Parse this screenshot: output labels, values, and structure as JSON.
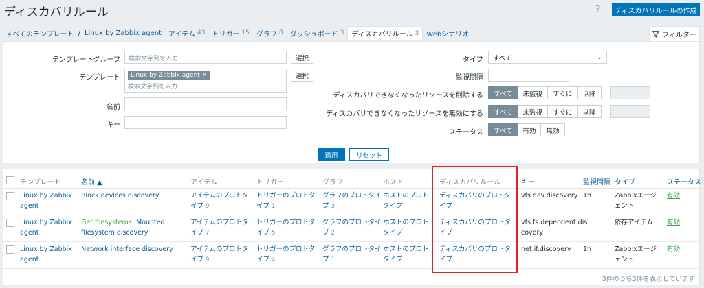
{
  "header": {
    "title": "ディスカバリルール",
    "help_icon": "?",
    "create_label": "ディスカバリルールの作成"
  },
  "breadcrumb": {
    "all_templates": "すべてのテンプレート",
    "separator": "/",
    "template": "Linux by Zabbix agent",
    "tabs": [
      {
        "label": "アイテム",
        "count": "43"
      },
      {
        "label": "トリガー",
        "count": "15"
      },
      {
        "label": "グラフ",
        "count": "8"
      },
      {
        "label": "ダッシュボード",
        "count": "3"
      },
      {
        "label": "ディスカバリルール",
        "count": "3"
      },
      {
        "label": "Webシナリオ",
        "count": ""
      }
    ]
  },
  "filter": {
    "tab_label": "フィルター",
    "template_group_label": "テンプレートグループ",
    "template_group_placeholder": "検索文字列を入力",
    "select_label": "選択",
    "template_label": "テンプレート",
    "template_chip": "Linux by Zabbix agent",
    "template_placeholder": "検索文字列を入力",
    "name_label": "名前",
    "key_label": "キー",
    "type_label": "タイプ",
    "type_value": "すべて",
    "interval_label": "監視間隔",
    "delete_lost_label": "ディスカバリできなくなったリソースを削除する",
    "disable_lost_label": "ディスカバリできなくなったリソースを無効にする",
    "lost_options": [
      "すべて",
      "未監視",
      "すぐに",
      "以降"
    ],
    "status_label": "ステータス",
    "status_options": [
      "すべて",
      "有効",
      "無効"
    ],
    "apply_label": "適用",
    "reset_label": "リセット"
  },
  "table": {
    "headers": {
      "template": "テンプレート",
      "name": "名前 ▲",
      "items": "アイテム",
      "triggers": "トリガー",
      "graphs": "グラフ",
      "hosts": "ホスト",
      "discovery": "ディスカバリルール",
      "key": "キー",
      "interval": "監視間隔",
      "type": "タイプ",
      "status": "ステータス"
    },
    "rows": [
      {
        "template_l1": "Linux by Zabbix",
        "template_l2": "agent",
        "name_l1": "Block devices discovery",
        "name_l2": "",
        "items_l1": "アイテムのプロトタ",
        "items_l2": "イプ",
        "items_count": "9",
        "triggers_l1": "トリガーのプロトタ",
        "triggers_l2": "イプ",
        "triggers_count": "1",
        "graphs_l1": "グラフのプロトタイ",
        "graphs_l2": "プ",
        "graphs_count": "3",
        "hosts_l1": "ホストのプロト",
        "hosts_l2": "タイプ",
        "discovery_l1": "ディスカバリのプロトタ",
        "discovery_l2": "イプ",
        "key_l1": "vfs.dev.discovery",
        "key_l2": "",
        "interval": "1h",
        "type_l1": "Zabbixエージ",
        "type_l2": "ェント",
        "status": "有効"
      },
      {
        "template_l1": "Linux by Zabbix",
        "template_l2": "agent",
        "name_prefix": "Get filesystems",
        "name_l1": ": Mounted",
        "name_l2": "filesystem discovery",
        "items_l1": "アイテムのプロトタ",
        "items_l2": "イプ",
        "items_count": "7",
        "triggers_l1": "トリガーのプロトタ",
        "triggers_l2": "イプ",
        "triggers_count": "5",
        "graphs_l1": "グラフのプロトタイ",
        "graphs_l2": "プ",
        "graphs_count": "2",
        "hosts_l1": "ホストのプロト",
        "hosts_l2": "タイプ",
        "discovery_l1": "ディスカバリのプロトタ",
        "discovery_l2": "イプ",
        "key_l1": "vfs.fs.dependent.dis",
        "key_l2": "covery",
        "interval": "",
        "type_l1": "依存アイテム",
        "type_l2": "",
        "status": "有効"
      },
      {
        "template_l1": "Linux by Zabbix",
        "template_l2": "agent",
        "name_l1": "Network interface discovery",
        "name_l2": "",
        "items_l1": "アイテムのプロトタ",
        "items_l2": "イプ",
        "items_count": "9",
        "triggers_l1": "トリガーのプロトタ",
        "triggers_l2": "イプ",
        "triggers_count": "4",
        "graphs_l1": "グラフのプロトタイ",
        "graphs_l2": "プ",
        "graphs_count": "1",
        "hosts_l1": "ホストのプロト",
        "hosts_l2": "タイプ",
        "discovery_l1": "ディスカバリのプロトタ",
        "discovery_l2": "イプ",
        "key_l1": "net.if.discovery",
        "key_l2": "",
        "interval": "1h",
        "type_l1": "Zabbixエージ",
        "type_l2": "ェント",
        "status": "有効"
      }
    ],
    "footer": "3件のうち3件を表示しています"
  },
  "colors": {
    "accent": "#0275b8",
    "highlight": "#e3232c",
    "enabled": "#429e47"
  }
}
